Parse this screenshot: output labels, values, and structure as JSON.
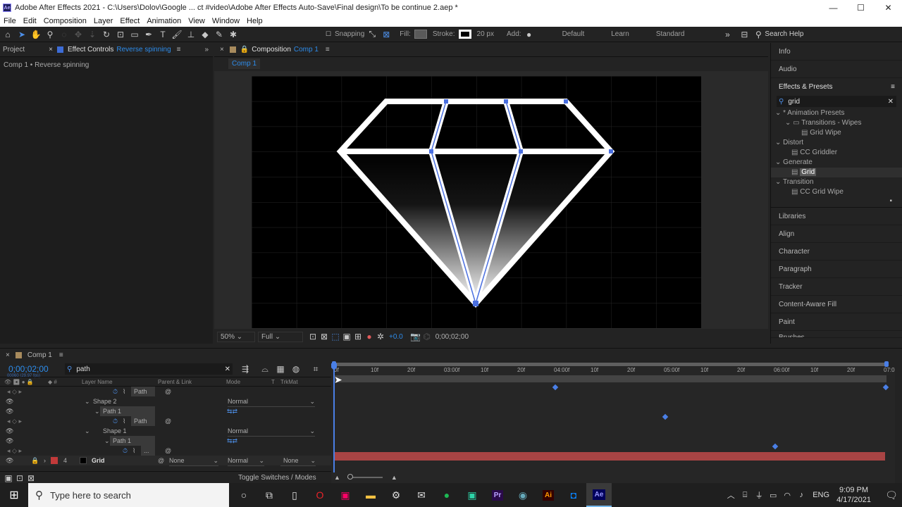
{
  "titlebar": {
    "logo": "Ae",
    "title": "Adobe After Effects 2021 - C:\\Users\\Dolov\\Google ... ct #video\\Adobe After Effects Auto-Save\\Final design\\To be continue 2.aep *",
    "min": "—",
    "max": "☐",
    "close": "✕"
  },
  "menu": [
    "File",
    "Edit",
    "Composition",
    "Layer",
    "Effect",
    "Animation",
    "View",
    "Window",
    "Help"
  ],
  "toolbar": {
    "snapping": "Snapping",
    "fill_label": "Fill:",
    "stroke_label": "Stroke:",
    "stroke_px": "20 px",
    "add_label": "Add:",
    "workspaces": [
      "Default",
      "Learn",
      "Standard"
    ],
    "search_help": "Search Help",
    "fill_color": "#5a5a5a"
  },
  "left_panel": {
    "tab_project": "Project",
    "tab_effects": "Effect Controls",
    "effects_target": "Reverse spinning",
    "breadcrumb": "Comp 1 • Reverse spinning"
  },
  "comp_panel": {
    "tab_label": "Composition",
    "tab_comp": "Comp 1",
    "subtab": "Comp 1",
    "zoom": "50%",
    "resolution": "Full",
    "exposure": "+0.0",
    "timecode": "0;00;02;00"
  },
  "right_panel": {
    "top_items": [
      "Info",
      "Audio"
    ],
    "effects_title": "Effects & Presets",
    "search_value": "grid",
    "tree": [
      {
        "label": "* Animation Presets",
        "level": 0,
        "type": "folder-open"
      },
      {
        "label": "Transitions - Wipes",
        "level": 1,
        "type": "folder"
      },
      {
        "label": "Grid Wipe",
        "level": 2,
        "type": "preset"
      },
      {
        "label": "Distort",
        "level": 0,
        "type": "folder-open"
      },
      {
        "label": "CC Griddler",
        "level": 1,
        "type": "effect"
      },
      {
        "label": "Generate",
        "level": 0,
        "type": "folder-open"
      },
      {
        "label": "Grid",
        "level": 1,
        "type": "effect",
        "selected": true
      },
      {
        "label": "Transition",
        "level": 0,
        "type": "folder-open"
      },
      {
        "label": "CC Grid Wipe",
        "level": 1,
        "type": "effect"
      }
    ],
    "bottom_items": [
      "Libraries",
      "Align",
      "Character",
      "Paragraph",
      "Tracker",
      "Content-Aware Fill",
      "Paint",
      "Brushes"
    ]
  },
  "timeline": {
    "tab": "Comp 1",
    "timecode": "0;00;02;00",
    "fps": "00060 (29.97 fps)",
    "search_value": "path",
    "col_layer_name": "Layer Name",
    "col_parent": "Parent & Link",
    "col_mode": "Mode",
    "col_t": "T",
    "col_trkmat": "TrkMat",
    "ruler": [
      "0f",
      "10f",
      "20f",
      "03:00f",
      "10f",
      "20f",
      "04:00f",
      "10f",
      "20f",
      "05:00f",
      "10f",
      "20f",
      "06:00f",
      "10f",
      "20f",
      "07:0"
    ],
    "rows": [
      {
        "kind": "path",
        "label": "Path"
      },
      {
        "kind": "shape",
        "label": "Shape 2",
        "mode": "Normal"
      },
      {
        "kind": "pathgroup",
        "label": "Path 1"
      },
      {
        "kind": "path",
        "label": "Path"
      },
      {
        "kind": "shape",
        "label": "Shape 1",
        "mode": "Normal"
      },
      {
        "kind": "pathgroup",
        "label": "Path 1"
      },
      {
        "kind": "path",
        "label": "..."
      },
      {
        "kind": "layer",
        "num": "4",
        "label": "Grid",
        "parent": "None",
        "mode": "Normal",
        "trkmat": "None"
      }
    ],
    "footer": "Toggle Switches / Modes"
  },
  "taskbar": {
    "search_placeholder": "Type here to search",
    "apps": [
      "cortana",
      "task-view",
      "file",
      "opera",
      "photos",
      "explorer",
      "settings",
      "mail",
      "spotify",
      "chat",
      "premiere",
      "web",
      "illustrator",
      "outlook",
      "after-effects"
    ],
    "app_labels": {
      "premiere": "Pr",
      "illustrator": "Ai",
      "after-effects": "Ae"
    },
    "lang": "ENG",
    "time": "9:09 PM",
    "date": "4/17/2021"
  }
}
